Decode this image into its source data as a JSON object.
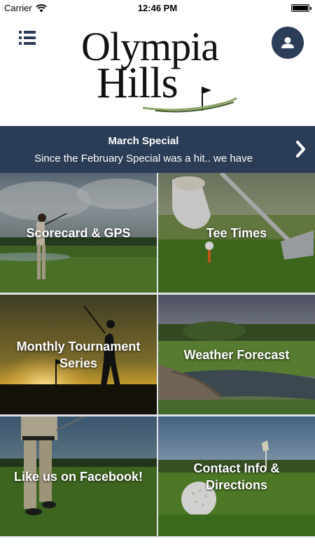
{
  "status_bar": {
    "carrier": "Carrier",
    "time": "12:46 PM"
  },
  "header": {
    "logo_line1": "Olympia",
    "logo_line2": "Hills",
    "menu_icon": "hamburger-menu-icon",
    "profile_icon": "user-icon"
  },
  "special": {
    "title": "March Special",
    "text": "Since the February Special was a hit.. we have"
  },
  "tiles": [
    {
      "label": "Scorecard & GPS",
      "photo": "golfer swinging on fairway"
    },
    {
      "label": "Tee Times",
      "photo": "gloved hand placing golf ball on tee"
    },
    {
      "label": "Monthly Tournament Series",
      "photo": "golfer silhouette at sunset"
    },
    {
      "label": "Weather Forecast",
      "photo": "golf course with pond and bridge"
    },
    {
      "label": "Like us on Facebook!",
      "photo": "golfer walking on course"
    },
    {
      "label": "Contact Info & Directions",
      "photo": "golf ball near green flag"
    }
  ],
  "colors": {
    "navy": "#2b3c56",
    "white": "#ffffff",
    "grid_gap": "#dfe3e8"
  }
}
